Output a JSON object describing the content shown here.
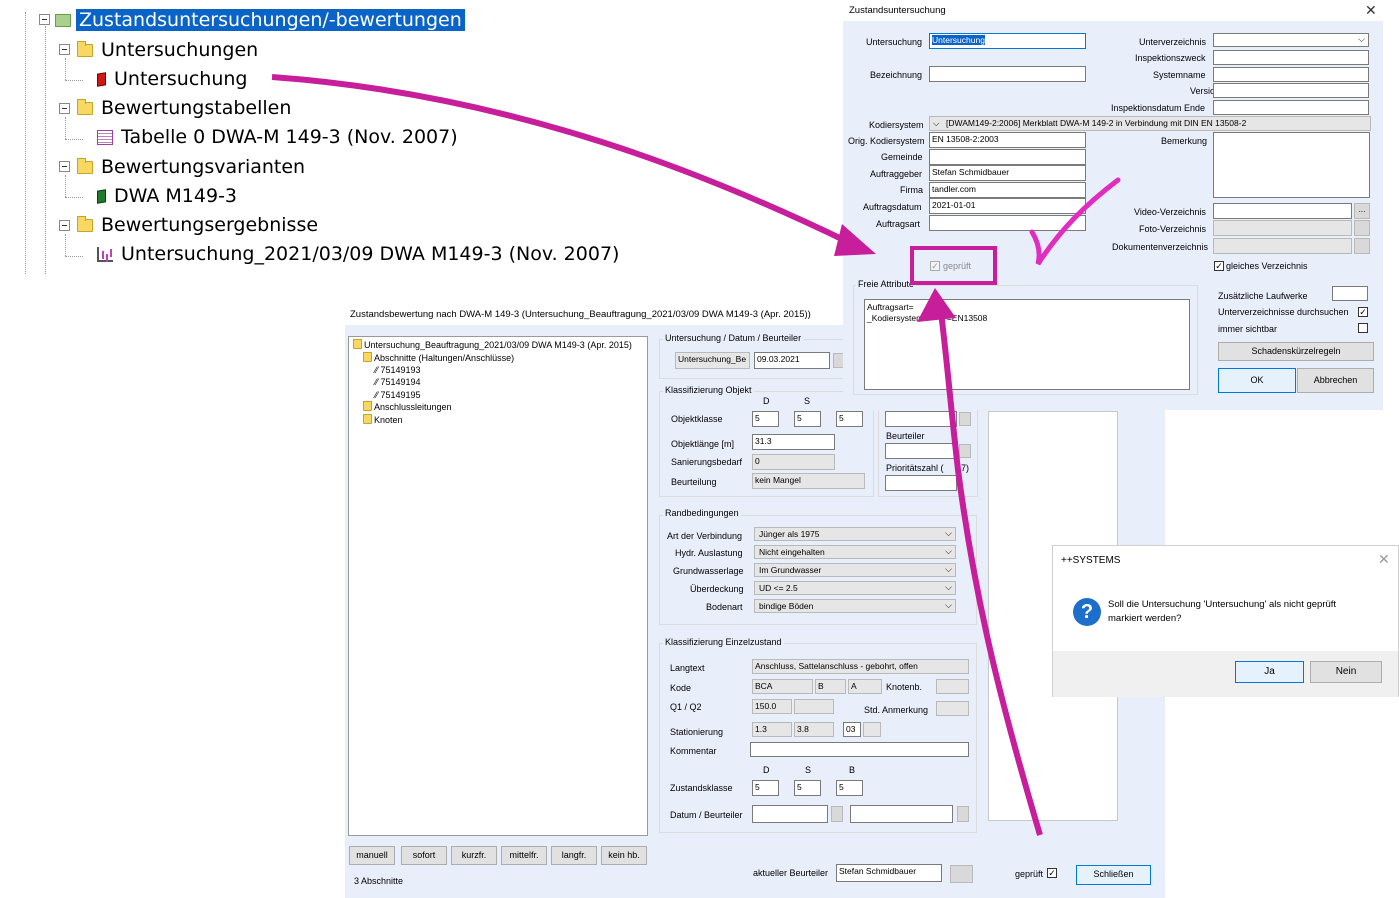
{
  "tree": {
    "items": [
      {
        "label": "Zustandsuntersuchungen/-bewertungen",
        "icon": "root-folder-icon"
      },
      {
        "label": "Untersuchungen",
        "icon": "folder-icon"
      },
      {
        "label": "Untersuchung",
        "icon": "red-book-icon"
      },
      {
        "label": "Bewertungstabellen",
        "icon": "folder-icon"
      },
      {
        "label": "Tabelle 0 DWA-M 149-3 (Nov. 2007)",
        "icon": "table-icon"
      },
      {
        "label": "Bewertungsvarianten",
        "icon": "folder-icon"
      },
      {
        "label": "DWA M149-3",
        "icon": "green-book-icon"
      },
      {
        "label": "Bewertungsergebnisse",
        "icon": "folder-icon"
      },
      {
        "label": "Untersuchung_2021/03/09 DWA M149-3 (Nov. 2007)",
        "icon": "chart-icon"
      }
    ]
  },
  "zu": {
    "title": "Zustandsuntersuchung",
    "close": "✕",
    "labels": {
      "untersuchung": "Untersuchung",
      "bezeichnung": "Bezeichnung",
      "kodiersystem": "Kodiersystem",
      "orig_kodiersystem": "Orig. Kodiersystem",
      "gemeinde": "Gemeinde",
      "auftraggeber": "Auftraggeber",
      "firma": "Firma",
      "auftragsdatum": "Auftragsdatum",
      "auftragsart": "Auftragsart",
      "unterverzeichnis": "Unterverzeichnis",
      "inspektionszweck": "Inspektionszweck",
      "systemname": "Systemname",
      "version": "Version",
      "inspektionsdatum_ende": "Inspektionsdatum Ende",
      "bemerkung": "Bemerkung",
      "video": "Video-Verzeichnis",
      "foto": "Foto-Verzeichnis",
      "dokumente": "Dokumentenverzeichnis",
      "geprueft": "geprüft",
      "gleiches": "gleiches Verzeichnis",
      "freie_attribute": "Freie Attribute",
      "laufwerke": "Zusätzliche Laufwerke",
      "durchsuchen": "Unterverzeichnisse durchsuchen",
      "sichtbar": "immer sichtbar"
    },
    "values": {
      "untersuchung": "Untersuchung",
      "kodiersystem": "[DWAM149-2:2006]   Merkblatt DWA-M 149-2 in Verbindung mit DIN EN 13508-2",
      "orig_kodiersystem": "EN 13508-2:2003",
      "auftraggeber": "Stefan Schmidbauer",
      "firma": "tandler.com",
      "auftragsdatum": "2021-01-01",
      "freie_attribute_line1": "Auftragsart=",
      "freie_attribute_line2": "_Kodiersystem",
      "freie_attribute_line2_tail": "'=EN13508"
    },
    "buttons": {
      "schadenskuerzel": "Schadenskürzelregeln",
      "ok": "OK",
      "abbrechen": "Abbrechen",
      "browse": "..."
    }
  },
  "zb": {
    "title": "Zustandsbewertung nach DWA-M 149-3 (Untersuchung_Beauftragung_2021/03/09 DWA M149-3 (Apr. 2015))",
    "tree": [
      "Untersuchung_Beauftragung_2021/03/09 DWA M149-3 (Apr. 2015)",
      "Abschnitte (Haltungen/Anschlüsse)",
      "75149193",
      "75149194",
      "75149195",
      "Anschlussleitungen",
      "Knoten"
    ],
    "groups": {
      "udb": "Untersuchung / Datum / Beurteiler",
      "objekt": "Klassifizierung Objekt",
      "rand": "Randbedingungen",
      "einzel": "Klassifizierung Einzelzustand"
    },
    "udb": {
      "untersuchung": "Untersuchung_Be",
      "datum": "09.03.2021"
    },
    "dsb": {
      "d": "D",
      "s": "S",
      "b": "B"
    },
    "objekt": {
      "objektklasse_label": "Objektklasse",
      "objektklasse": [
        "5",
        "5",
        "5"
      ],
      "laenge_label": "Objektlänge [m]",
      "laenge": "31.3",
      "sanierung_label": "Sanierungsbedarf",
      "sanierung": "0",
      "beurteilung_label": "Beurteilung",
      "beurteilung": "kein Mangel",
      "beurteiler_label": "Beurteiler",
      "prioritaet_label": "Prioritätszahl (",
      "prioritaet_tail": "7)"
    },
    "rand": {
      "verbindung_label": "Art der Verbindung",
      "verbindung": "Jünger als 1975",
      "auslastung_label": "Hydr. Auslastung",
      "auslastung": "Nicht eingehalten",
      "grundwasser_label": "Grundwasserlage",
      "grundwasser": "Im Grundwasser",
      "ueberdeckung_label": "Überdeckung",
      "ueberdeckung": "UD <= 2.5",
      "bodenart_label": "Bodenart",
      "bodenart": "bindige Böden"
    },
    "einzel": {
      "langtext_label": "Langtext",
      "langtext": "Anschluss, Sattelanschluss - gebohrt, offen",
      "kode_label": "Kode",
      "kode": [
        "BCA",
        "B",
        "A"
      ],
      "knotenb_label": "Knotenb.",
      "q_label": "Q1 / Q2",
      "q1": "150.0",
      "std_label": "Std. Anmerkung",
      "station_label": "Stationierung",
      "station": [
        "1.3",
        "3.8",
        "03"
      ],
      "kommentar_label": "Kommentar",
      "zustand_label": "Zustandsklasse",
      "zustand": [
        "5",
        "5",
        "5"
      ],
      "datum_label": "Datum / Beurteiler"
    },
    "buttons": [
      "manuell",
      "sofort",
      "kurzfr.",
      "mittelfr.",
      "langfr.",
      "kein hb."
    ],
    "count": "3 Abschnitte",
    "aktueller_label": "aktueller Beurteiler",
    "aktueller": "Stefan Schmidbauer",
    "geprueft": "geprüft",
    "schliessen": "Schließen"
  },
  "msg": {
    "title": "++SYSTEMS",
    "close": "✕",
    "icon": "question-icon",
    "text1": "Soll die Untersuchung 'Untersuchung' als nicht geprüft",
    "text2": "markiert werden?",
    "ja": "Ja",
    "nein": "Nein"
  },
  "colors": {
    "accent": "#c71f9b",
    "selection": "#0a64c8",
    "dialog_bg": "#e9eefb"
  }
}
